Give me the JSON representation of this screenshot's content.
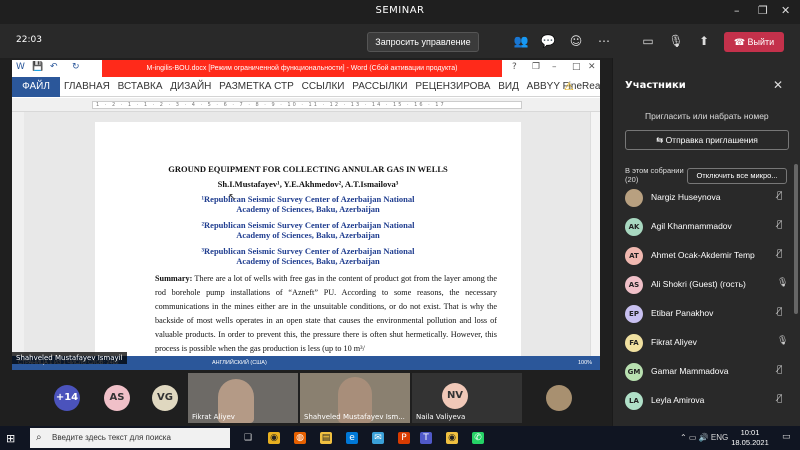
{
  "window": {
    "title": "SEMINAR"
  },
  "meeting": {
    "time": "22:03",
    "request_control": "Запросить управление",
    "leave": "Выйти"
  },
  "word": {
    "doc_title": "M-ingilis-BOU.docx [Режим ограниченной функциональности] - Word (Сбой активации продукта)",
    "file_tab": "ФАЙЛ",
    "tabs": [
      "ГЛАВНАЯ",
      "ВСТАВКА",
      "ДИЗАЙН",
      "РАЗМЕТКА СТР",
      "ССЫЛКИ",
      "РАССЫЛКИ",
      "РЕЦЕНЗИРОВА",
      "ВИД",
      "ABBYY FineRea"
    ],
    "status_left": "СТРАНИЦА 1 ИЗ 1    ЧИСЛО СЛОВ: 2482",
    "status_lang": "АНГЛИЙСКИЙ (США)",
    "zoom": "100%"
  },
  "paper": {
    "title": "GROUND EQUIPMENT FOR COLLECTING ANNULAR GAS IN WELLS",
    "authors": "Sh.I.Mustafayev¹, Y.E.Akhmedov², A.T.Ismailova³",
    "affiliations": [
      {
        "line1": "¹Republican Seismic Survey Center of Azerbaijan National",
        "line2": "Academy of Sciences, Baku, Azerbaijan"
      },
      {
        "line1": "²Republican Seismic Survey Center of Azerbaijan National",
        "line2": "Academy of Sciences, Baku, Azerbaijan"
      },
      {
        "line1": "³Republican Seismic Survey Center of Azerbaijan National",
        "line2": "Academy of Sciences, Baku, Azerbaijan"
      }
    ],
    "summary_label": "Summary:",
    "summary_text": "There are a lot of wells with free gas in the content of product got from the layer among the rod borehole pump installations of “Azneft” PU. According to some reasons, the necessary communications in the mines either are in the unsuitable conditions, or do not exist. That is why the backside of most wells operates in an open state that causes the environmental pollution and loss of valuable products. In order to prevent this, the pressure there is often shut hermetically. However, this process is possible when the gas production is less (up to 10 m³/"
  },
  "presenter": "Shahveled Mustafayev Ismayil",
  "gallery": {
    "overflow": "+14",
    "bubbles": [
      "AS",
      "VG",
      "NV"
    ],
    "tiles": [
      {
        "name": "Fikrat Aliyev"
      },
      {
        "name": "Shahveled Mustafayev Ism..."
      },
      {
        "name": "Naila Valiyeva"
      }
    ]
  },
  "panel": {
    "title": "Участники",
    "invite_placeholder": "Пригласить или набрать номер",
    "share_invite": "Отправка приглашения",
    "in_meeting": "В этом собрании (20)",
    "mute_all": "Отключить все микро...",
    "participants": [
      {
        "initials": "",
        "name": "Nargiz Huseynova",
        "color": "#b8a080"
      },
      {
        "initials": "AK",
        "name": "Agil Khanmammadov",
        "color": "#a8d8c0"
      },
      {
        "initials": "AT",
        "name": "Ahmet Ocak-Akdemir Temp",
        "color": "#f0b8b0"
      },
      {
        "initials": "AS",
        "name": "Ali Shokri (Guest) (гость)",
        "color": "#f0c0c8"
      },
      {
        "initials": "EP",
        "name": "Etibar Panakhov",
        "color": "#c8c0f0"
      },
      {
        "initials": "FA",
        "name": "Fikrat Aliyev",
        "color": "#f0e0a0"
      },
      {
        "initials": "GM",
        "name": "Gamar Mammadova",
        "color": "#b8e0b0"
      },
      {
        "initials": "LA",
        "name": "Leyla Amirova",
        "color": "#b0e0c8"
      }
    ]
  },
  "taskbar": {
    "search_placeholder": "Введите здесь текст для поиска",
    "lang": "ENG",
    "clock_time": "10:01",
    "clock_date": "18.05.2021"
  },
  "colors": {
    "word_blue": "#2b579a",
    "leave_red": "#c4314b",
    "activation_red": "#ff2a1a"
  }
}
